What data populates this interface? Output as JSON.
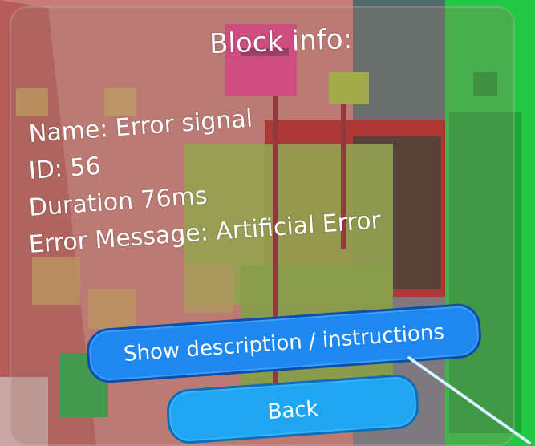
{
  "panel": {
    "title": "Block info:",
    "fields": {
      "name": "Name: Error signal",
      "id": "ID: 56",
      "duration": "Duration 76ms",
      "error": "Error Message: Artificial Error"
    },
    "buttons": {
      "show_description": "Show description / instructions",
      "back": "Back"
    }
  },
  "colors": {
    "button_primary": "#1e88f0",
    "button_back": "#1ea6f2",
    "panel_tint": "rgba(160,120,110,0.30)",
    "laser_pointer": "#bfe9ff"
  }
}
